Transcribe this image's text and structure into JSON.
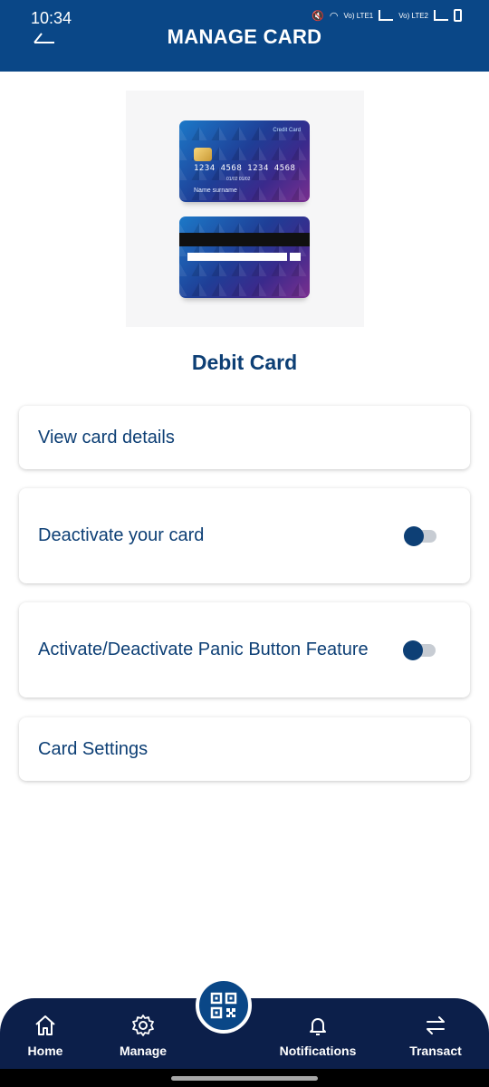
{
  "status_bar": {
    "time": "10:34",
    "net1": "Vo) LTE1",
    "net2": "Vo) LTE2"
  },
  "header": {
    "title": "MANAGE CARD"
  },
  "card_image": {
    "front_label": "Credit Card",
    "number": "1234 4568 1234 4568",
    "dates": "01/02   01/02",
    "name": "Name surname"
  },
  "card_type": "Debit Card",
  "options": [
    {
      "label": "View card details"
    },
    {
      "label": "Deactivate your card",
      "toggle_on": false
    },
    {
      "label": "Activate/Deactivate Panic Button Feature",
      "toggle_on": false
    },
    {
      "label": "Card Settings"
    }
  ],
  "bottom_nav": {
    "items": [
      {
        "label": "Home",
        "icon": "home-icon"
      },
      {
        "label": "Manage",
        "icon": "gear-icon"
      },
      {
        "label": "Notifications",
        "icon": "bell-icon"
      },
      {
        "label": "Transact",
        "icon": "swap-arrows-icon"
      }
    ],
    "center_icon": "qr-code-icon"
  },
  "colors": {
    "primary": "#0a4787",
    "text": "#0d3f75",
    "nav_bg": "#0c1f4a"
  }
}
